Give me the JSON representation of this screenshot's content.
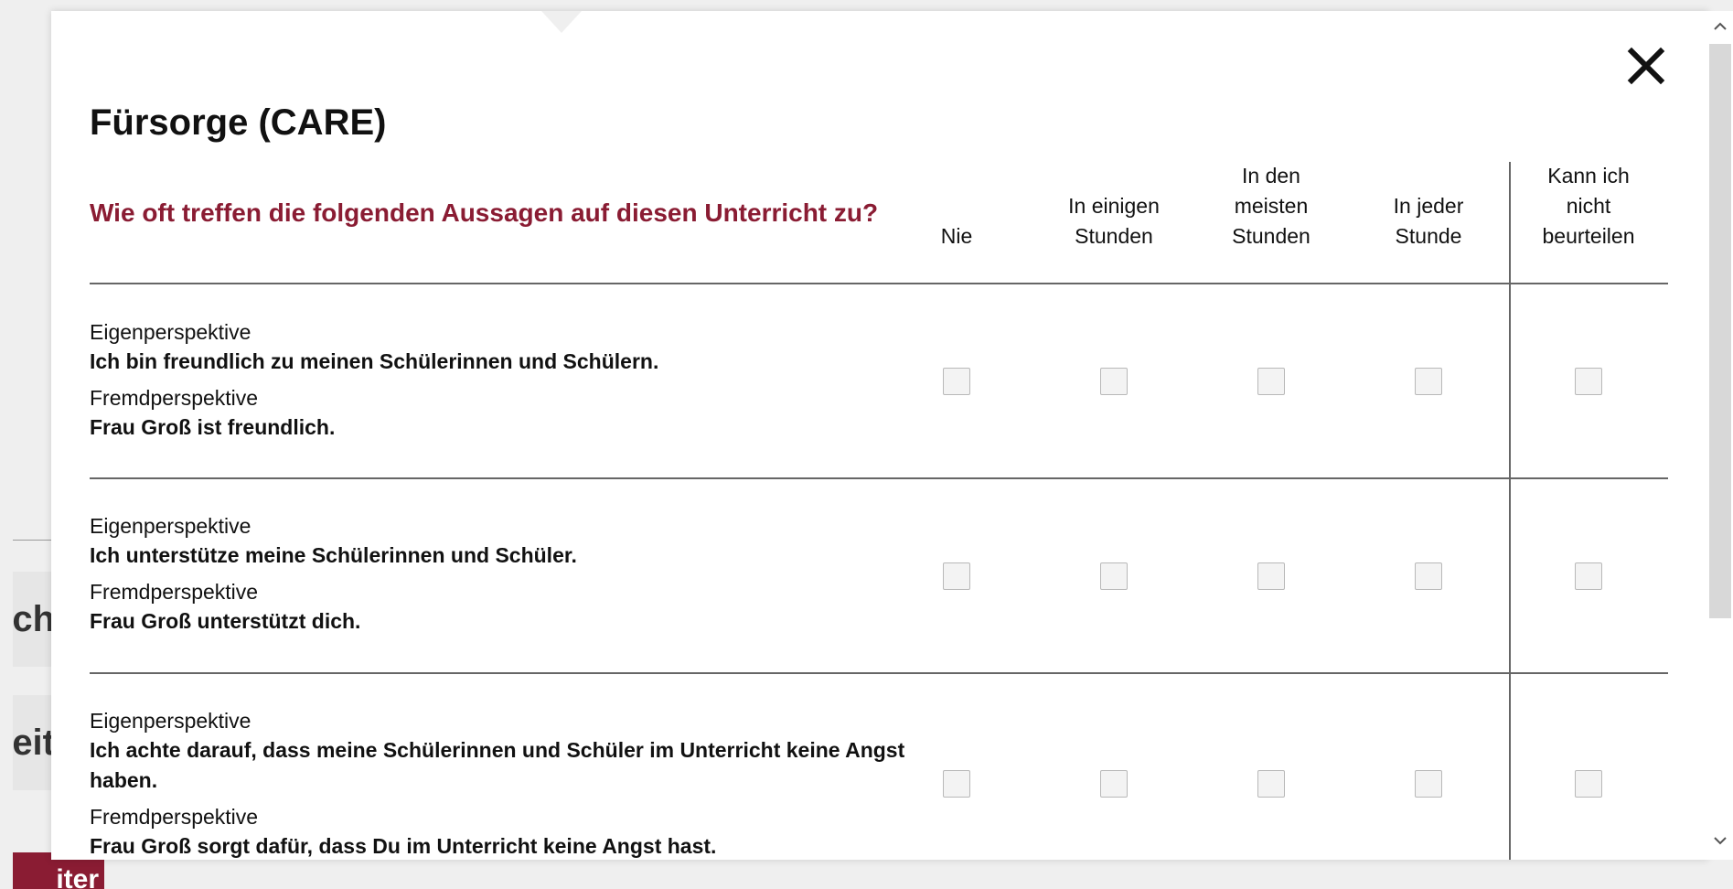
{
  "background": {
    "fragment_1": "ich",
    "fragment_2": "Weit",
    "fragment_3": "iter",
    "accent_color": "#8a1c33"
  },
  "modal": {
    "title": "Fürsorge (CARE)",
    "question": "Wie oft treffen die folgenden Aussagen auf diesen Unterricht zu?",
    "close_icon": "close-icon",
    "columns": [
      "Nie",
      "In einigen\nStunden",
      "In den\nmeisten\nStunden",
      "In jeder\nStunde",
      "Kann ich\nnicht\nbeurteilen"
    ],
    "items": [
      {
        "self_label": "Eigenperspektive",
        "self_text": "Ich bin freundlich zu meinen Schülerinnen und Schülern.",
        "other_label": "Fremdperspektive",
        "other_text": "Frau Groß ist freundlich."
      },
      {
        "self_label": "Eigenperspektive",
        "self_text": "Ich unterstütze meine Schülerinnen und Schüler.",
        "other_label": "Fremdperspektive",
        "other_text": "Frau Groß unterstützt dich."
      },
      {
        "self_label": "Eigenperspektive",
        "self_text": "Ich achte darauf, dass meine Schülerinnen und Schüler im Unterricht keine Angst haben.",
        "other_label": "Fremdperspektive",
        "other_text": "Frau Groß sorgt dafür, dass Du im Unterricht keine Angst hast."
      }
    ]
  },
  "scrollbar": {
    "up_icon": "chevron-up-icon",
    "down_icon": "chevron-down-icon"
  }
}
